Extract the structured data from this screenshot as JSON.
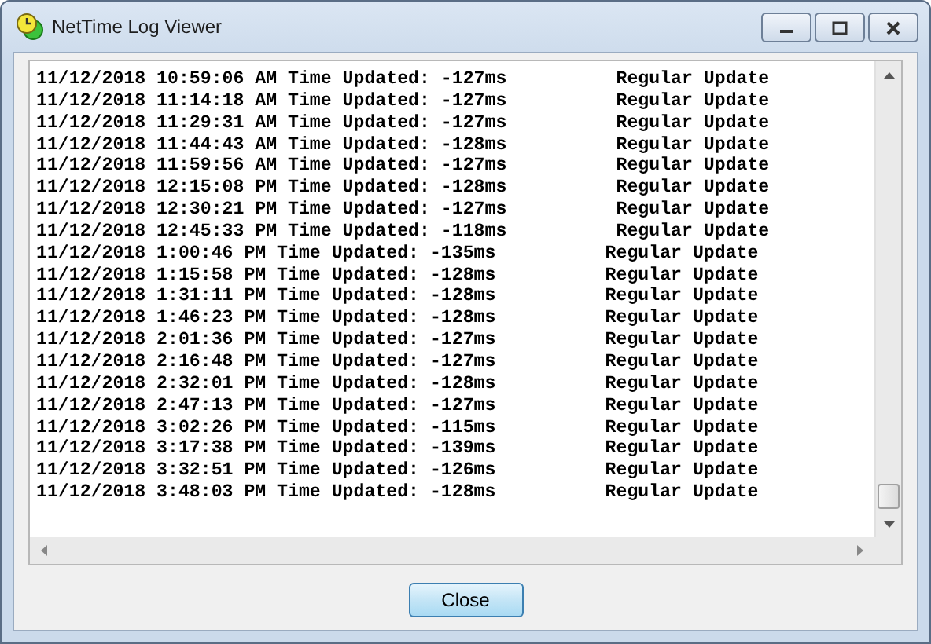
{
  "window": {
    "title": "NetTime Log Viewer"
  },
  "log": {
    "lines": [
      "11/12/2018 10:59:06 AM Time Updated: -127ms          Regular Update",
      "11/12/2018 11:14:18 AM Time Updated: -127ms          Regular Update",
      "11/12/2018 11:29:31 AM Time Updated: -127ms          Regular Update",
      "11/12/2018 11:44:43 AM Time Updated: -128ms          Regular Update",
      "11/12/2018 11:59:56 AM Time Updated: -127ms          Regular Update",
      "11/12/2018 12:15:08 PM Time Updated: -128ms          Regular Update",
      "11/12/2018 12:30:21 PM Time Updated: -127ms          Regular Update",
      "11/12/2018 12:45:33 PM Time Updated: -118ms          Regular Update",
      "11/12/2018 1:00:46 PM Time Updated: -135ms          Regular Update",
      "11/12/2018 1:15:58 PM Time Updated: -128ms          Regular Update",
      "11/12/2018 1:31:11 PM Time Updated: -128ms          Regular Update",
      "11/12/2018 1:46:23 PM Time Updated: -128ms          Regular Update",
      "11/12/2018 2:01:36 PM Time Updated: -127ms          Regular Update",
      "11/12/2018 2:16:48 PM Time Updated: -127ms          Regular Update",
      "11/12/2018 2:32:01 PM Time Updated: -128ms          Regular Update",
      "11/12/2018 2:47:13 PM Time Updated: -127ms          Regular Update",
      "11/12/2018 3:02:26 PM Time Updated: -115ms          Regular Update",
      "11/12/2018 3:17:38 PM Time Updated: -139ms          Regular Update",
      "11/12/2018 3:32:51 PM Time Updated: -126ms          Regular Update",
      "11/12/2018 3:48:03 PM Time Updated: -128ms          Regular Update"
    ]
  },
  "buttons": [
    {
      "label": "Close"
    }
  ]
}
